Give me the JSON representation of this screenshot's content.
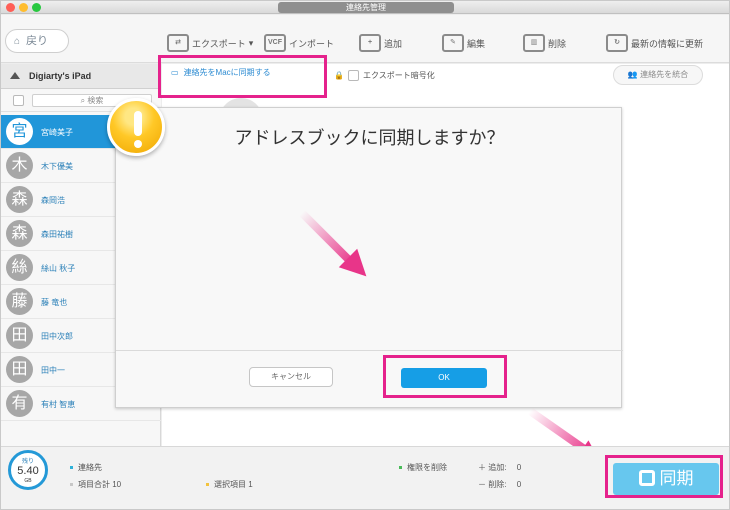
{
  "window": {
    "title": "連絡先管理"
  },
  "toolbar": {
    "back_label": "戻り",
    "export_label": "エクスポート",
    "import_label": "インポート",
    "add_label": "追加",
    "edit_label": "編集",
    "delete_label": "削除",
    "refresh_label": "最新の情報に更新",
    "vcf_label": "VCF"
  },
  "sidebar": {
    "device_name": "Digiarty's iPad",
    "search_placeholder": "検索",
    "contacts": [
      {
        "initial": "宮",
        "name": "宮崎美子"
      },
      {
        "initial": "木",
        "name": "木下優美"
      },
      {
        "initial": "森",
        "name": "森岡浩"
      },
      {
        "initial": "森",
        "name": "森田祐樹"
      },
      {
        "initial": "絲",
        "name": "絲山 秋子"
      },
      {
        "initial": "藤",
        "name": "藤 竜也"
      },
      {
        "initial": "田",
        "name": "田中次郎"
      },
      {
        "initial": "田",
        "name": "田中一"
      },
      {
        "initial": "有",
        "name": "有村 智恵"
      }
    ]
  },
  "main": {
    "sync_mac_label": "連絡先をMacに同期する",
    "export_encrypt_label": "エクスポート暗号化",
    "merge_label": "連絡先を統合"
  },
  "dialog": {
    "title": "アドレスブックに同期しますか？",
    "cancel_label": "キャンセル",
    "ok_label": "OK"
  },
  "bottom": {
    "storage_label": "残り",
    "storage_value": "5.40",
    "storage_unit": "GB",
    "contacts_label": "連絡先",
    "total_label": "項目合計 10",
    "selected_label": "選択項目 1",
    "delete_permission_label": "権限を削除",
    "add_status_label": "追加:",
    "add_status_value": "0",
    "delete_status_label": "削除:",
    "delete_status_value": "0",
    "sync_label": "同期"
  },
  "colors": {
    "accent": "#2196d9",
    "highlight": "#e5228c",
    "ok": "#169ee6",
    "sync": "#67c7ee"
  }
}
